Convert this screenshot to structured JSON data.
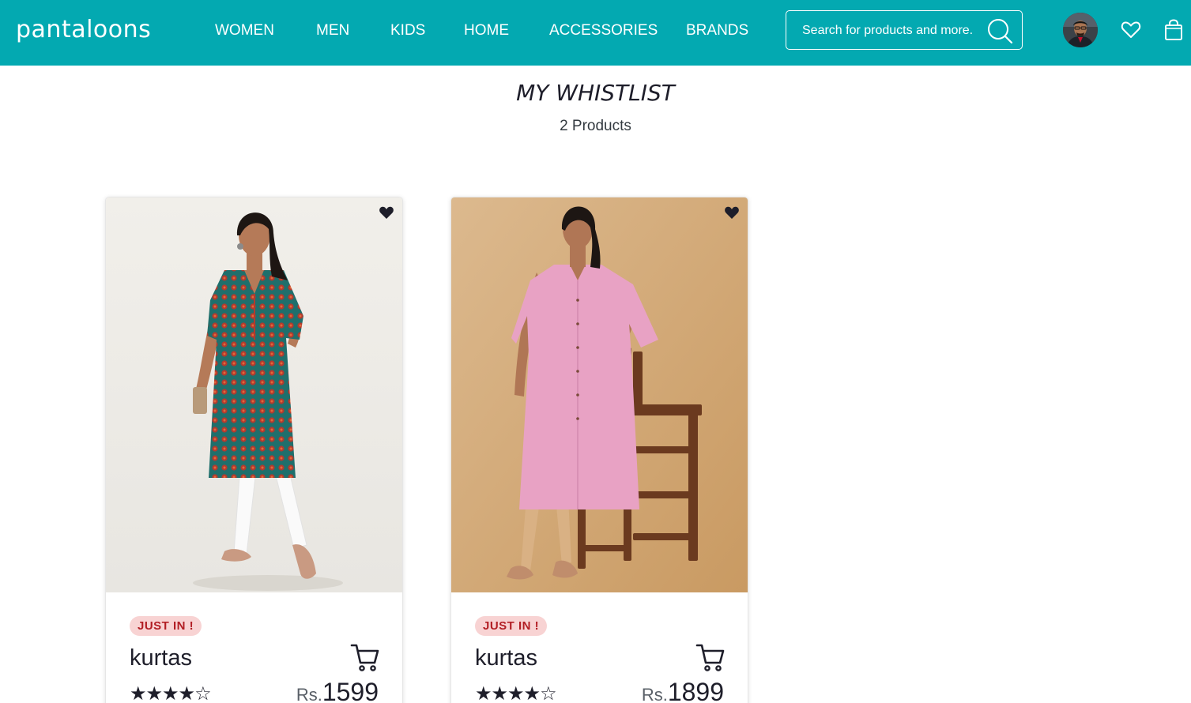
{
  "header": {
    "logo": "pantaloons",
    "nav": [
      "WOMEN",
      "MEN",
      "KIDS",
      "HOME",
      "ACCESSORIES",
      "BRANDS"
    ],
    "search": {
      "placeholder": "Search for products and more.",
      "value": ""
    },
    "icons": {
      "search": "search-icon",
      "avatar": "user-avatar",
      "wishlist": "heart-icon",
      "bag": "shopping-bag-icon"
    },
    "colors": {
      "bar": "#03a9b1",
      "text": "#ffffff"
    }
  },
  "page": {
    "title": "MY WHISTLIST",
    "count": "2 Products"
  },
  "products": [
    {
      "badge": "JUST IN !",
      "name": "kurtas",
      "rating": 4,
      "rating_max": 5,
      "stars_text": "★★★★☆",
      "currency": "Rs.",
      "price": "1599",
      "image": "woman-in-teal-printed-kurta"
    },
    {
      "badge": "JUST IN !",
      "name": "kurtas",
      "rating": 4,
      "rating_max": 5,
      "stars_text": "★★★★☆",
      "currency": "Rs.",
      "price": "1899",
      "image": "woman-in-pink-kurta-with-chair"
    }
  ],
  "colors": {
    "badge_bg": "#f8d3d3",
    "badge_text": "#b21e24"
  }
}
